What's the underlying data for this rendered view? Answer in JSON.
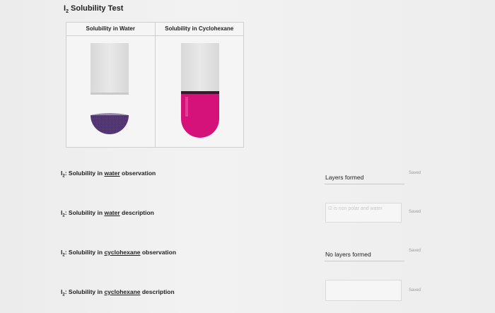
{
  "title": {
    "prefix": "I",
    "subscript": "2",
    "text": " Solubility Test"
  },
  "table": {
    "headers": [
      "Solubility in Water",
      "Solubility in Cyclohexane"
    ]
  },
  "colors": {
    "water_layer": "#4a2f6b",
    "cyclohexane_solution": "#d5117a",
    "tube_glass": "#e0e0e0"
  },
  "questions": [
    {
      "prefix": "I",
      "sub": "2",
      "pre": ": Solubility in ",
      "solvent": "water",
      "post": " observation",
      "answer": "Layers formed",
      "placeholder": "",
      "status": "Saved"
    },
    {
      "prefix": "I",
      "sub": "2",
      "pre": ": Solubility in ",
      "solvent": "water",
      "post": " description",
      "answer": "",
      "placeholder": "I2 is non polar and water",
      "status": "Saved"
    },
    {
      "prefix": "I",
      "sub": "2",
      "pre": ": Solubility in ",
      "solvent": "cyclohexane",
      "post": " observation",
      "answer": "No layers formed",
      "placeholder": "",
      "status": "Saved"
    },
    {
      "prefix": "I",
      "sub": "2",
      "pre": ": Solubility in ",
      "solvent": "cyclohexane",
      "post": " description",
      "answer": "",
      "placeholder": "",
      "status": "Saved"
    }
  ]
}
